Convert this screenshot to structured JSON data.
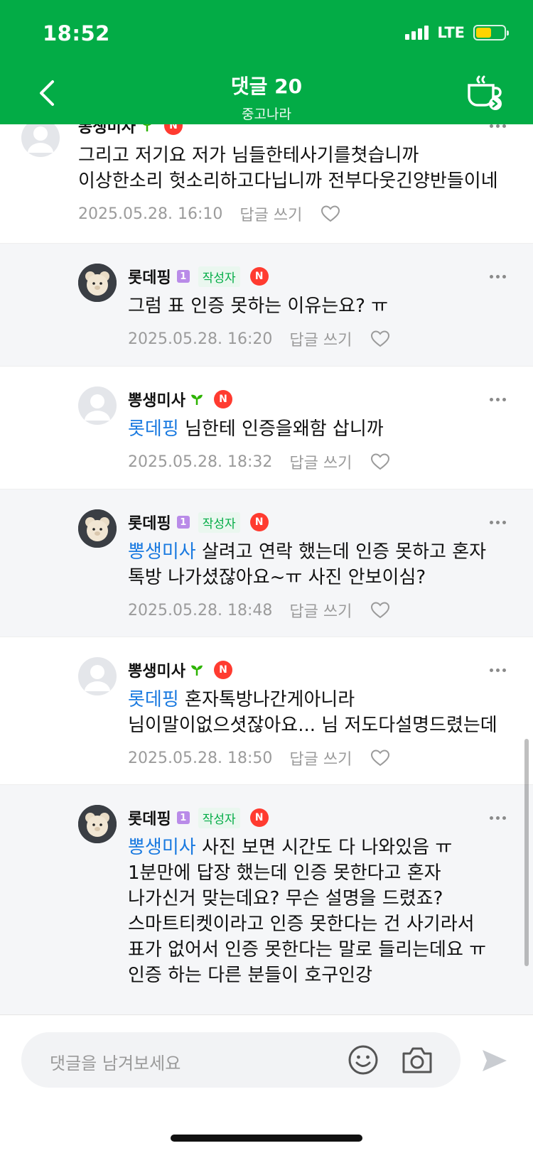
{
  "status_bar": {
    "time": "18:52",
    "network": "LTE"
  },
  "header": {
    "title": "댓글 20",
    "subtitle": "중고나라"
  },
  "comments": [
    {
      "nickname": "뽕생미사",
      "mention": "",
      "text": "그리고 저기요 저가 님들한테사기를쳣습니까 이상한소리 헛소리하고다닙니까 전부다웃긴양반들이네",
      "date": "2025.05.28. 16:10",
      "reply_label": "답글 쓰기"
    },
    {
      "nickname": "롯데핑",
      "level": "1",
      "author_badge": "작성자",
      "mention": "",
      "text": "그럼 표 인증 못하는 이유는요? ㅠ",
      "date": "2025.05.28. 16:20",
      "reply_label": "답글 쓰기"
    },
    {
      "nickname": "뽕생미사",
      "mention": "롯데핑",
      "text": " 님한테 인증을왜함 삽니까",
      "date": "2025.05.28. 18:32",
      "reply_label": "답글 쓰기"
    },
    {
      "nickname": "롯데핑",
      "level": "1",
      "author_badge": "작성자",
      "mention": "뽕생미사",
      "text": " 살려고 연락 했는데 인증 못하고 혼자 톡방 나가셨잖아요~ㅠ 사진 안보이심?",
      "date": "2025.05.28. 18:48",
      "reply_label": "답글 쓰기"
    },
    {
      "nickname": "뽕생미사",
      "mention": "롯데핑",
      "text": " 혼자톡방나간게아니라 님이말이없으셧잖아요... 님 저도다설명드렸는데",
      "date": "2025.05.28. 18:50",
      "reply_label": "답글 쓰기"
    },
    {
      "nickname": "롯데핑",
      "level": "1",
      "author_badge": "작성자",
      "mention": "뽕생미사",
      "text": " 사진 보면 시간도 다 나와있음 ㅠ 1분만에 답장 했는데 인증 못한다고 혼자 나가신거 맞는데요? 무슨 설명을 드렸죠? 스마트티켓이라고 인증 못한다는 건 사기라서 표가 없어서 인증 못한다는 말로 들리는데요 ㅠ 인증 하는 다른 분들이 호구인강",
      "date": "",
      "reply_label": ""
    }
  ],
  "input": {
    "placeholder": "댓글을 남겨보세요"
  },
  "colors": {
    "brand": "#03ac46",
    "mention": "#1a7ae0",
    "reply_bg": "#f5f6f8",
    "n_badge": "#ff3b30"
  }
}
